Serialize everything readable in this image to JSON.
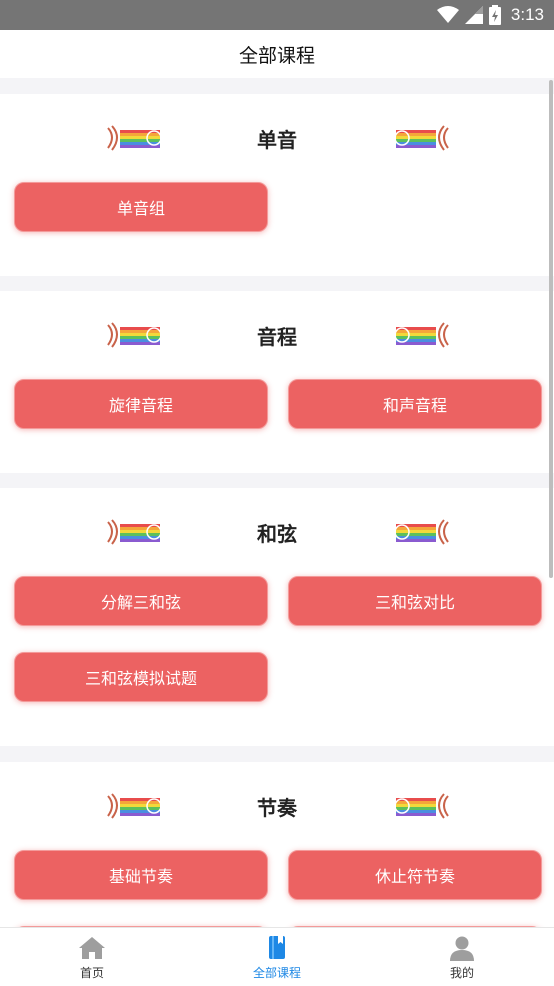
{
  "status_bar": {
    "time": "3:13",
    "icons": [
      "wifi-icon",
      "signal-icon",
      "battery-icon"
    ]
  },
  "header": {
    "title": "全部课程"
  },
  "sections": [
    {
      "title": "单音",
      "buttons": [
        "单音组"
      ]
    },
    {
      "title": "音程",
      "buttons": [
        "旋律音程",
        "和声音程"
      ]
    },
    {
      "title": "和弦",
      "buttons": [
        "分解三和弦",
        "三和弦对比",
        "三和弦模拟试题"
      ]
    },
    {
      "title": "节奏",
      "buttons": [
        "基础节奏",
        "休止符节奏"
      ]
    }
  ],
  "tab_bar": {
    "tabs": [
      {
        "label": "首页",
        "icon": "home-icon",
        "active": false
      },
      {
        "label": "全部课程",
        "icon": "book-icon",
        "active": true
      },
      {
        "label": "我的",
        "icon": "user-icon",
        "active": false
      }
    ]
  },
  "colors": {
    "button": "#ec6262",
    "active_tab": "#1e88e5",
    "status_bar": "#757575"
  }
}
